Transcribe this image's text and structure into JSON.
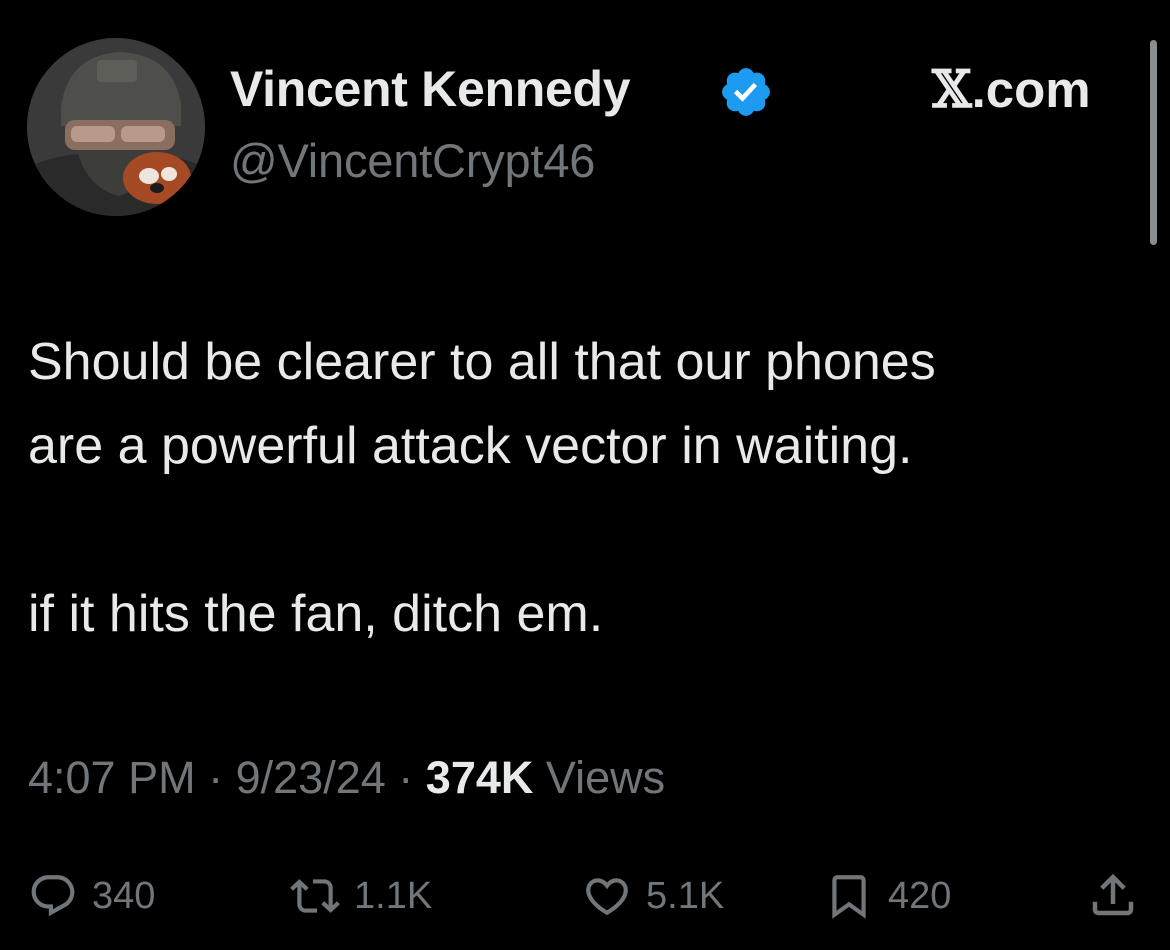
{
  "author": {
    "display_name": "Vincent Kennedy",
    "handle": "@VincentCrypt46",
    "verified": true,
    "verified_color": "#1d9bf0"
  },
  "brand": {
    "x_glyph": "𝕏",
    "suffix": ".com"
  },
  "tweet": {
    "text": "Should be clearer to all that our phones\nare a powerful attack vector in waiting.\n\nif it hits the fan, ditch em."
  },
  "meta": {
    "time": "4:07 PM",
    "sep1": "·",
    "date": "9/23/24",
    "sep2": "·",
    "views_count": "374K",
    "views_label": "Views"
  },
  "actions": {
    "replies": {
      "icon": "reply-icon",
      "count": "340"
    },
    "reposts": {
      "icon": "repost-icon",
      "count": "1.1K"
    },
    "likes": {
      "icon": "heart-icon",
      "count": "5.1K"
    },
    "bookmarks": {
      "icon": "bookmark-icon",
      "count": "420"
    },
    "share": {
      "icon": "share-icon"
    }
  },
  "colors": {
    "background": "#000000",
    "text_primary": "#e7e9ea",
    "text_secondary": "#71767b"
  }
}
